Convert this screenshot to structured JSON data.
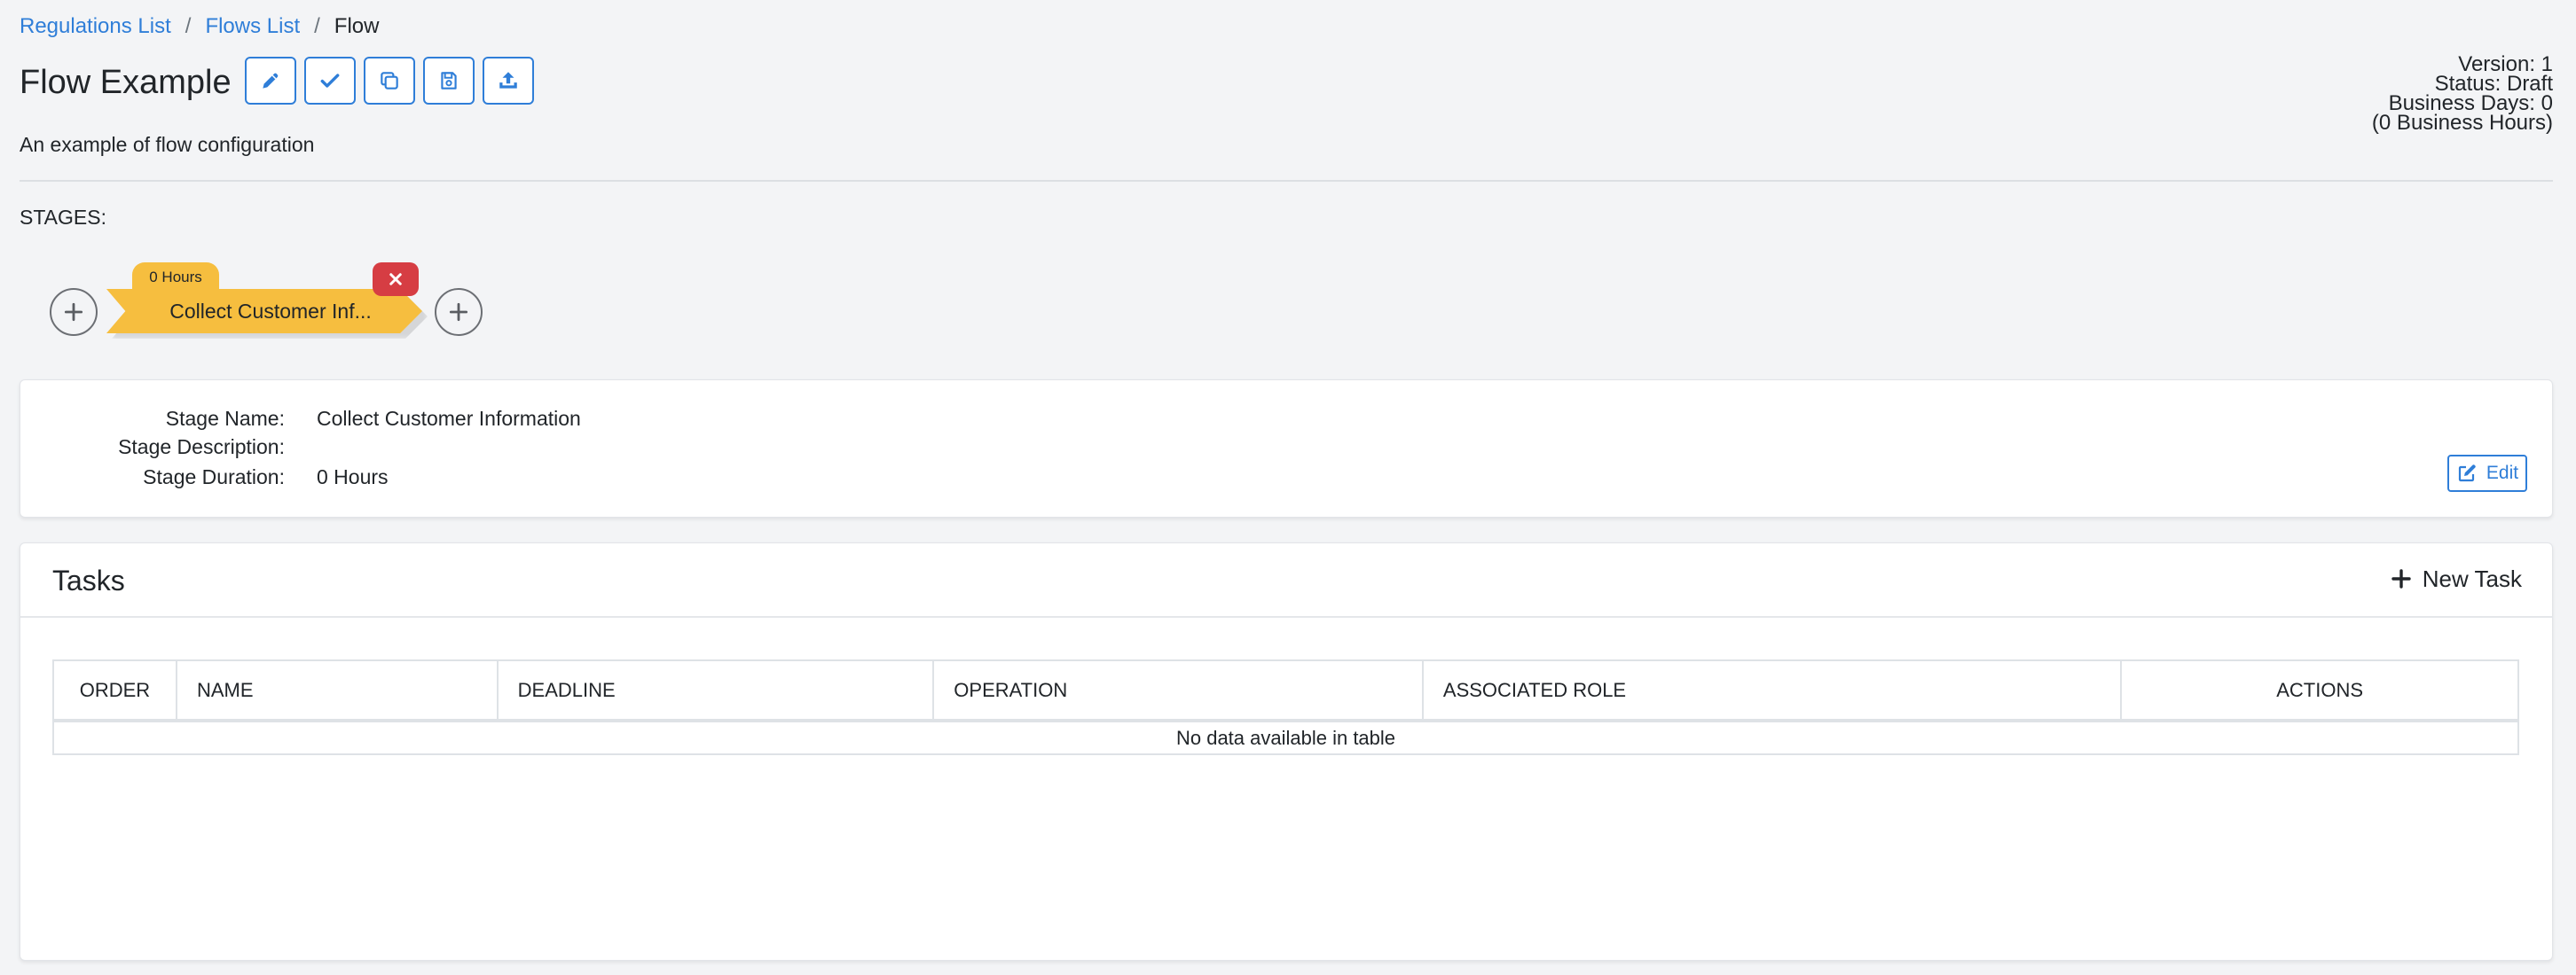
{
  "breadcrumb": {
    "items": [
      "Regulations List",
      "Flows List"
    ],
    "separator": "/",
    "current": "Flow"
  },
  "header": {
    "title": "Flow Example",
    "description": "An example of flow configuration",
    "toolbar": [
      {
        "name": "edit-flow-button",
        "icon": "pencil-icon"
      },
      {
        "name": "validate-flow-button",
        "icon": "check-icon"
      },
      {
        "name": "copy-flow-button",
        "icon": "copy-icon"
      },
      {
        "name": "save-flow-button",
        "icon": "save-icon"
      },
      {
        "name": "publish-flow-button",
        "icon": "upload-icon"
      }
    ]
  },
  "meta": {
    "version": "Version: 1",
    "status": "Status: Draft",
    "business_days": "Business Days: 0",
    "business_hours": "(0 Business Hours)"
  },
  "stages": {
    "label": "STAGES:",
    "items": [
      {
        "duration_tab": "0 Hours",
        "label": "Collect Customer Inf...",
        "color": "#f6be3f"
      }
    ]
  },
  "stage_detail": {
    "name_label": "Stage Name:",
    "name_value": "Collect Customer Information",
    "description_label": "Stage Description:",
    "description_value": "",
    "duration_label": "Stage Duration:",
    "duration_value": "0 Hours",
    "edit_label": "Edit"
  },
  "tasks": {
    "title": "Tasks",
    "new_task_label": "New Task",
    "columns": [
      "ORDER",
      "NAME",
      "DEADLINE",
      "OPERATION",
      "ASSOCIATED ROLE",
      "ACTIONS"
    ],
    "empty_message": "No data available in table"
  },
  "colors": {
    "accent": "#2f7ed8",
    "stage": "#f6be3f",
    "danger": "#d63d43"
  }
}
